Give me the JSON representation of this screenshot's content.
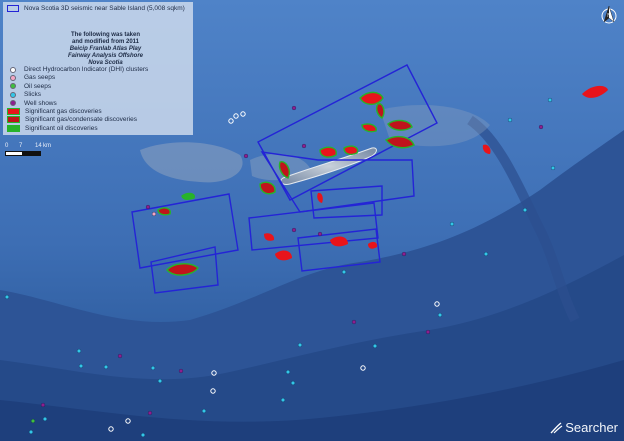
{
  "legend": {
    "survey_label": "Nova Scotia 3D seismic near Sable Island (5,008 sqkm)",
    "note_lines": [
      "The following was taken",
      "and modified from 2011",
      "Beicip Franlab Atlas Play",
      "Fairway Analysis Offshore",
      "Nova Scotia"
    ],
    "items": [
      {
        "label": "Direct Hydrocarbon Indicator (DHI) clusters",
        "color": "#ffffff",
        "shape": "circle"
      },
      {
        "label": "Gas seeps",
        "color": "#f4a6c4",
        "shape": "circle"
      },
      {
        "label": "Oil seeps",
        "color": "#3fbf3f",
        "shape": "circle"
      },
      {
        "label": "Slicks",
        "color": "#33c6e8",
        "shape": "circle"
      },
      {
        "label": "Well shows",
        "color": "#8e1e8e",
        "shape": "circle"
      },
      {
        "label": "Significant gas discoveries",
        "color": "#e8141b",
        "shape": "rect"
      },
      {
        "label": "Significant gas/condensate discoveries",
        "color": "#c0141b",
        "shape": "rect"
      },
      {
        "label": "Significant oil discoveries",
        "color": "#27b32a",
        "shape": "rect"
      }
    ]
  },
  "scale": {
    "ticks": [
      "0",
      "7",
      "14"
    ],
    "unit": "km"
  },
  "north_label": "N",
  "brand": "Searcher",
  "colors": {
    "survey_outline": "#2424d6",
    "deep": "#1b3f7a",
    "shelf": "#4f7fc4",
    "slope": "#345c9e"
  },
  "icons": {
    "north": "north-arrow-icon",
    "brand": "searcher-logo-icon"
  }
}
